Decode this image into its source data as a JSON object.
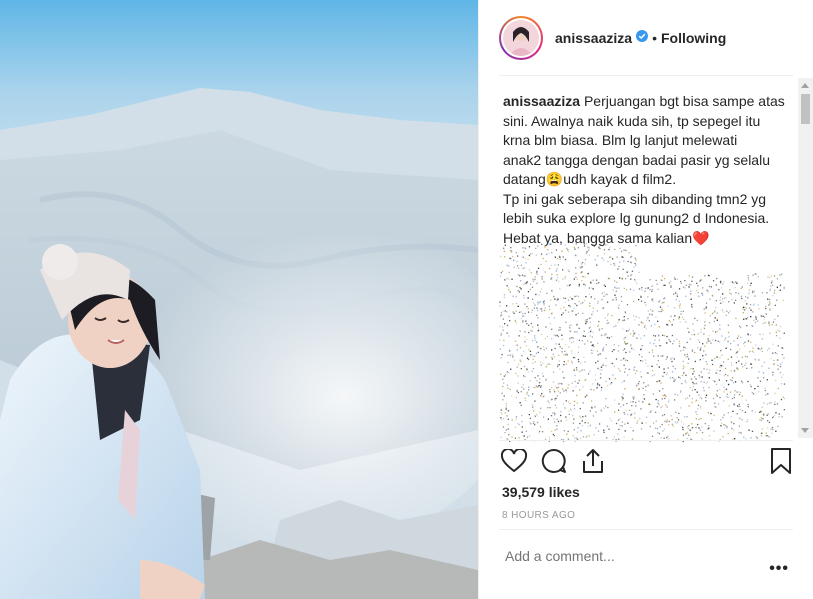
{
  "post": {
    "username": "anissaaziza",
    "follow_label": "Following",
    "separator": "•",
    "caption_user": "anissaaziza",
    "caption_lines": [
      " Perjuangan bgt bisa sampe atas",
      "sini. Awalnya naik kuda sih, tp sepegel itu",
      "krna blm biasa. Blm lg lanjut melewati",
      "anak2 tangga dengan badai pasir yg selalu",
      "datang😩udh kayak d film2.",
      "Tp ini gak seberapa sih dibanding tmn2 yg",
      "lebih suka explore lg gunung2 d Indonesia.",
      "Hebat ya, bangga sama kalian❤️"
    ],
    "likes": "39,579 likes",
    "time_ago": "8 HOURS AGO",
    "comment_placeholder": "Add a comment...",
    "more_label": "•••"
  },
  "icons": {
    "like": "heart-icon",
    "comment": "comment-icon",
    "share": "share-icon",
    "save": "bookmark-icon",
    "verified": "verified-badge-icon"
  },
  "colors": {
    "verified": "#3897f0",
    "text": "#262626",
    "muted": "#999999"
  }
}
